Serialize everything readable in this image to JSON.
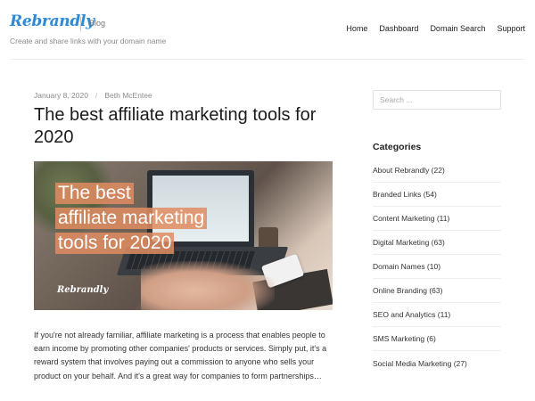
{
  "header": {
    "logo_text": "Rebrandly",
    "section_label": "Blog",
    "tagline": "Create and share links with your domain name",
    "nav": [
      "Home",
      "Dashboard",
      "Domain Search",
      "Support"
    ]
  },
  "article": {
    "date": "January 8, 2020",
    "separator": "/",
    "author": "Beth McEntee",
    "title": "The best affiliate marketing tools for 2020",
    "hero": {
      "overlay_lines": [
        "The best",
        "affiliate marketing",
        "tools for 2020"
      ],
      "brand_text": "Rebrandly",
      "overlay_color": "#e08c60"
    },
    "excerpt": "If you're not already familiar, affiliate marketing is a process that enables people to earn income by promoting other companies' products or services. Simply put, it's a reward system that involves paying out a commission to anyone who sells your product on your behalf. And it's a great way for companies to form partnerships…"
  },
  "sidebar": {
    "search_placeholder": "Search ...",
    "categories_title": "Categories",
    "categories": [
      "About Rebrandly (22)",
      "Branded Links (54)",
      "Content Marketing (11)",
      "Digital Marketing (63)",
      "Domain Names (10)",
      "Online Branding (63)",
      "SEO and Analytics (11)",
      "SMS Marketing (6)",
      "Social Media Marketing (27)"
    ]
  },
  "colors": {
    "brand_blue": "#2d8ad6",
    "text_dark": "#1b1b1b",
    "text_muted": "#8a8a8a"
  }
}
